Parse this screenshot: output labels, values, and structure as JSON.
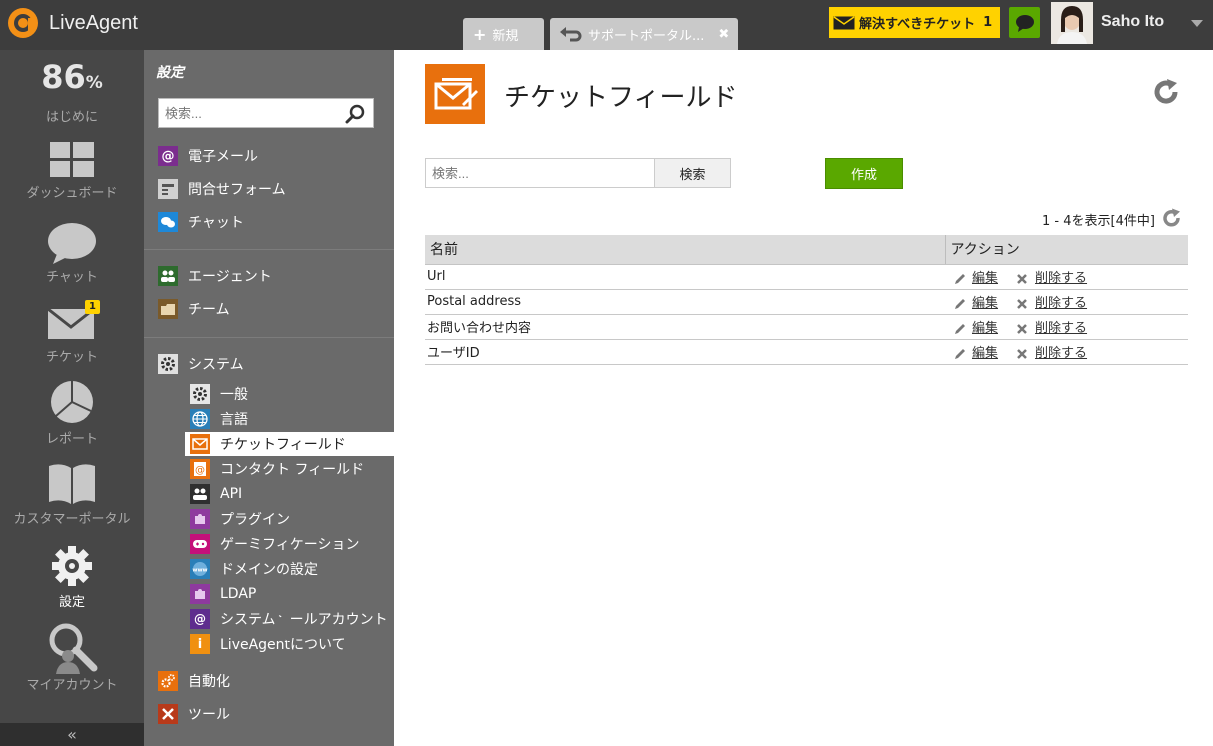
{
  "app": {
    "name": "LiveAgent"
  },
  "tabs": [
    {
      "label": "新規"
    },
    {
      "label": "サポートポータル..."
    }
  ],
  "header": {
    "ticket_alert_label": "解決すべきチケット",
    "ticket_alert_count": "1",
    "user_name": "Saho Ito"
  },
  "rail": {
    "percent": "86",
    "percent_unit": "%",
    "items": [
      {
        "label": "はじめに"
      },
      {
        "label": "ダッシュボード"
      },
      {
        "label": "チャット"
      },
      {
        "label": "チケット",
        "badge": "1"
      },
      {
        "label": "レポート"
      },
      {
        "label": "カスタマーポータル"
      },
      {
        "label": "設定"
      },
      {
        "label": "マイアカウント"
      }
    ],
    "collapse": "«"
  },
  "sidebar": {
    "title": "設定",
    "search_placeholder": "検索...",
    "group1": [
      {
        "label": "電子メール",
        "icon": "at-icon",
        "color": "#7b2d8e"
      },
      {
        "label": "問合せフォーム",
        "icon": "form-icon",
        "color": "#cfcfcf"
      },
      {
        "label": "チャット",
        "icon": "chat-icon",
        "color": "#1e88d8"
      }
    ],
    "group2": [
      {
        "label": "エージェント",
        "icon": "agents-icon",
        "color": "#2e6b2e"
      },
      {
        "label": "チーム",
        "icon": "folder-icon",
        "color": "#7a5a2a"
      }
    ],
    "system": {
      "label": "システム",
      "icon": "gear-icon"
    },
    "system_items": [
      {
        "label": "一般",
        "icon": "gear-icon",
        "color": "#555555"
      },
      {
        "label": "言語",
        "icon": "globe-icon",
        "color": "#2a7fb8"
      },
      {
        "label": "チケットフィールド",
        "icon": "ticket-fields-icon",
        "color": "#e8700d"
      },
      {
        "label": "コンタクト フィールド",
        "icon": "contact-fields-icon",
        "color": "#e8700d"
      },
      {
        "label": "API",
        "icon": "api-icon",
        "color": "#333333"
      },
      {
        "label": "プラグイン",
        "icon": "puzzle-icon",
        "color": "#8e3a9e"
      },
      {
        "label": "ゲーミフィケーション",
        "icon": "gamepad-icon",
        "color": "#c4107a"
      },
      {
        "label": "ドメインの設定",
        "icon": "www-icon",
        "color": "#2a7fb8"
      },
      {
        "label": "LDAP",
        "icon": "puzzle-icon",
        "color": "#8e3a9e"
      },
      {
        "label": "システムメールアカウント",
        "icon": "mail-account-icon",
        "color": "#5e2d8e"
      },
      {
        "label": "LiveAgentについて",
        "icon": "info-icon",
        "color": "#f09010"
      }
    ],
    "group3": [
      {
        "label": "自動化",
        "icon": "automation-icon",
        "color": "#e8700d"
      },
      {
        "label": "ツール",
        "icon": "tools-icon",
        "color": "#b83a1a"
      }
    ]
  },
  "main": {
    "title": "チケットフィールド",
    "search_placeholder": "検索...",
    "search_button": "検索",
    "create_button": "作成",
    "paging": "1 - 4を表示[4件中]",
    "columns": [
      "名前",
      "アクション"
    ],
    "rows": [
      {
        "name": "Url"
      },
      {
        "name": "Postal address"
      },
      {
        "name": "お問い合わせ内容"
      },
      {
        "name": "ユーザID"
      }
    ],
    "edit_label": "編集",
    "delete_label": "削除する"
  },
  "colors": {
    "accent_orange": "#e8700d",
    "accent_green": "#5aa800",
    "alert_yellow": "#ffd200"
  }
}
